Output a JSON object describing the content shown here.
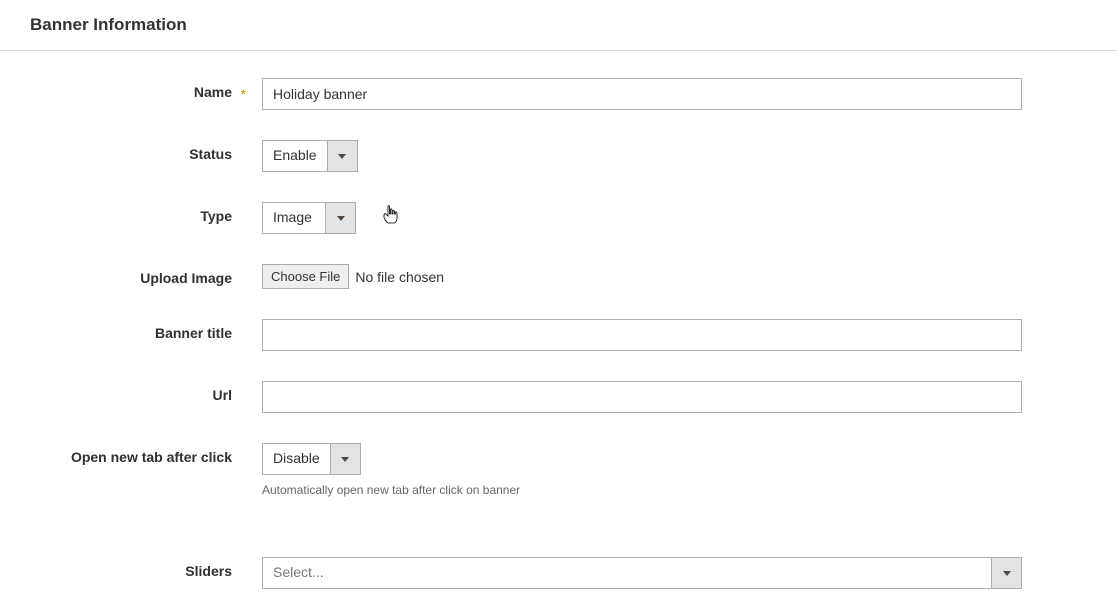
{
  "section": {
    "title": "Banner Information"
  },
  "fields": {
    "name": {
      "label": "Name",
      "required_mark": "*",
      "value": "Holiday banner"
    },
    "status": {
      "label": "Status",
      "value": "Enable"
    },
    "type": {
      "label": "Type",
      "value": "Image"
    },
    "upload_image": {
      "label": "Upload Image",
      "button": "Choose File",
      "status": "No file chosen"
    },
    "banner_title": {
      "label": "Banner title",
      "value": ""
    },
    "url": {
      "label": "Url",
      "value": ""
    },
    "open_new_tab": {
      "label": "Open new tab after click",
      "value": "Disable",
      "helper": "Automatically open new tab after click on banner"
    },
    "sliders": {
      "label": "Sliders",
      "placeholder": "Select..."
    }
  }
}
